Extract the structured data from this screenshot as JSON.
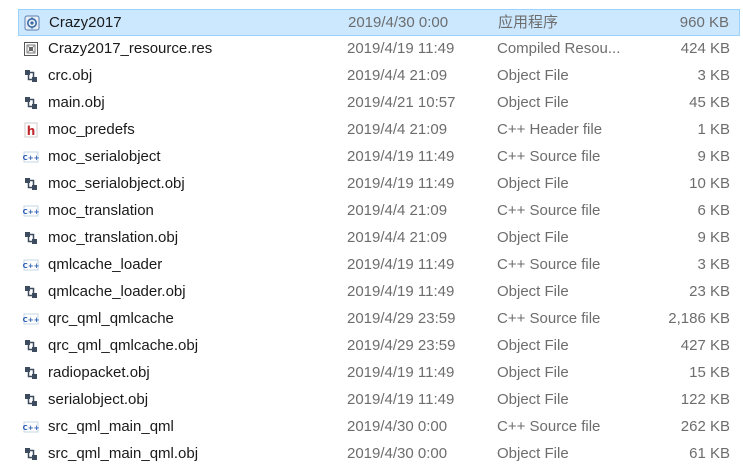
{
  "files": [
    {
      "name": "Crazy2017",
      "date": "2019/4/30 0:00",
      "type": "应用程序",
      "size": "960 KB",
      "icon": "app-icon",
      "selected": true
    },
    {
      "name": "Crazy2017_resource.res",
      "date": "2019/4/19 11:49",
      "type": "Compiled Resou...",
      "size": "424 KB",
      "icon": "resource-icon"
    },
    {
      "name": "crc.obj",
      "date": "2019/4/4 21:09",
      "type": "Object File",
      "size": "3 KB",
      "icon": "object-file-icon"
    },
    {
      "name": "main.obj",
      "date": "2019/4/21 10:57",
      "type": "Object File",
      "size": "45 KB",
      "icon": "object-file-icon"
    },
    {
      "name": "moc_predefs",
      "date": "2019/4/4 21:09",
      "type": "C++ Header file",
      "size": "1 KB",
      "icon": "header-file-icon"
    },
    {
      "name": "moc_serialobject",
      "date": "2019/4/19 11:49",
      "type": "C++ Source file",
      "size": "9 KB",
      "icon": "cpp-source-icon"
    },
    {
      "name": "moc_serialobject.obj",
      "date": "2019/4/19 11:49",
      "type": "Object File",
      "size": "10 KB",
      "icon": "object-file-icon"
    },
    {
      "name": "moc_translation",
      "date": "2019/4/4 21:09",
      "type": "C++ Source file",
      "size": "6 KB",
      "icon": "cpp-source-icon"
    },
    {
      "name": "moc_translation.obj",
      "date": "2019/4/4 21:09",
      "type": "Object File",
      "size": "9 KB",
      "icon": "object-file-icon"
    },
    {
      "name": "qmlcache_loader",
      "date": "2019/4/19 11:49",
      "type": "C++ Source file",
      "size": "3 KB",
      "icon": "cpp-source-icon"
    },
    {
      "name": "qmlcache_loader.obj",
      "date": "2019/4/19 11:49",
      "type": "Object File",
      "size": "23 KB",
      "icon": "object-file-icon"
    },
    {
      "name": "qrc_qml_qmlcache",
      "date": "2019/4/29 23:59",
      "type": "C++ Source file",
      "size": "2,186 KB",
      "icon": "cpp-source-icon"
    },
    {
      "name": "qrc_qml_qmlcache.obj",
      "date": "2019/4/29 23:59",
      "type": "Object File",
      "size": "427 KB",
      "icon": "object-file-icon"
    },
    {
      "name": "radiopacket.obj",
      "date": "2019/4/19 11:49",
      "type": "Object File",
      "size": "15 KB",
      "icon": "object-file-icon"
    },
    {
      "name": "serialobject.obj",
      "date": "2019/4/19 11:49",
      "type": "Object File",
      "size": "122 KB",
      "icon": "object-file-icon"
    },
    {
      "name": "src_qml_main_qml",
      "date": "2019/4/30 0:00",
      "type": "C++ Source file",
      "size": "262 KB",
      "icon": "cpp-source-icon"
    },
    {
      "name": "src_qml_main_qml.obj",
      "date": "2019/4/30 0:00",
      "type": "Object File",
      "size": "61 KB",
      "icon": "object-file-icon"
    }
  ]
}
